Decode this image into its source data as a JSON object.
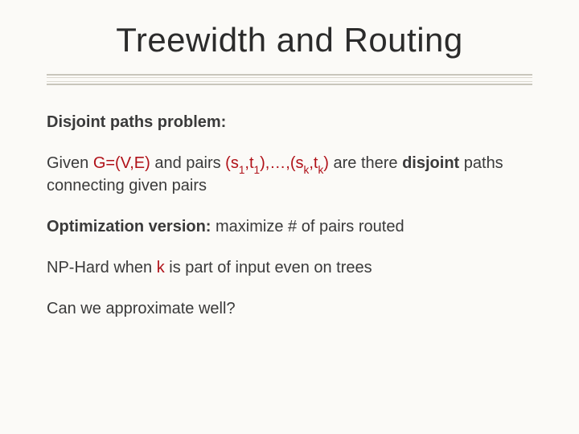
{
  "title": "Treewidth  and Routing",
  "p1": {
    "heading": "Disjoint paths problem:"
  },
  "p2": {
    "t1": "Given ",
    "graph": "G=(V,E)",
    "t2": " and pairs ",
    "pair1a": "(s",
    "pair1b": ",t",
    "pair1c": "),…,(s",
    "pair1d": ",t",
    "pair1e": ")",
    "sub1": "1",
    "subk": "k",
    "t3": " are there ",
    "disjoint": "disjoint",
    "t4": " paths connecting given pairs"
  },
  "p3": {
    "label": "Optimization version:",
    "rest": " maximize # of pairs routed"
  },
  "p4": {
    "t1": "NP-Hard when ",
    "k": "k",
    "t2": " is part of input even on trees"
  },
  "p5": {
    "text": "Can we approximate well?"
  }
}
